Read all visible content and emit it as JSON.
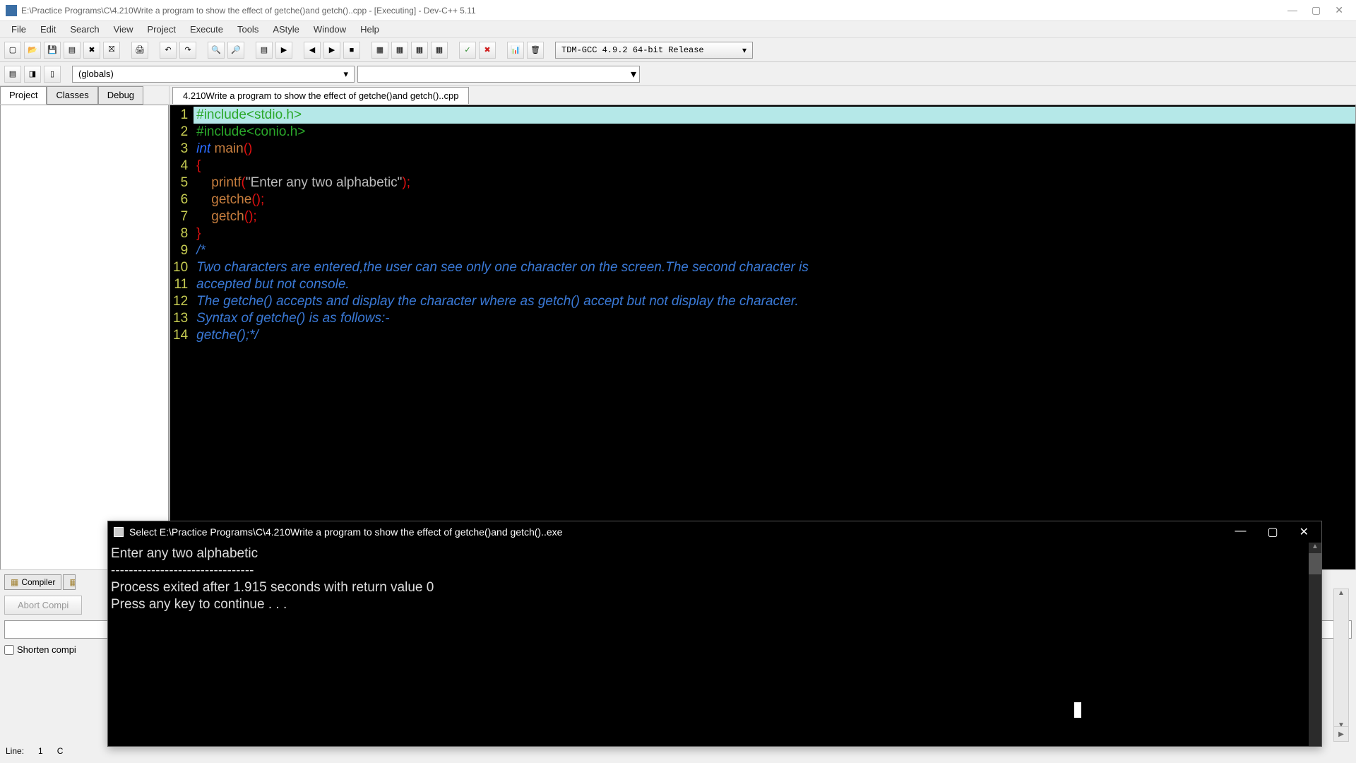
{
  "window": {
    "title": "E:\\Practice Programs\\C\\4.210Write a program to show the effect of getche()and getch()..cpp - [Executing] - Dev-C++ 5.11"
  },
  "menus": [
    "File",
    "Edit",
    "Search",
    "View",
    "Project",
    "Execute",
    "Tools",
    "AStyle",
    "Window",
    "Help"
  ],
  "compiler_profile": "TDM-GCC 4.9.2 64-bit Release",
  "globals_label": "(globals)",
  "left_tabs": [
    "Project",
    "Classes",
    "Debug"
  ],
  "editor_tab": "4.210Write a program to show the effect of getche()and getch()..cpp",
  "code_lines": [
    {
      "n": 1,
      "hl": true,
      "parts": [
        {
          "cls": "tok-pre",
          "t": "#include<stdio.h>"
        }
      ]
    },
    {
      "n": 2,
      "parts": [
        {
          "cls": "tok-pre",
          "t": "#include<conio.h>"
        }
      ]
    },
    {
      "n": 3,
      "parts": [
        {
          "cls": "tok-kw",
          "t": "int "
        },
        {
          "cls": "tok-fn",
          "t": "main"
        },
        {
          "cls": "tok-sym",
          "t": "()"
        }
      ]
    },
    {
      "n": 4,
      "parts": [
        {
          "cls": "tok-brace",
          "t": "{"
        }
      ]
    },
    {
      "n": 5,
      "parts": [
        {
          "cls": "tok-plain",
          "t": "    "
        },
        {
          "cls": "tok-fn",
          "t": "printf"
        },
        {
          "cls": "tok-sym",
          "t": "("
        },
        {
          "cls": "tok-str",
          "t": "\"Enter any two alphabetic\""
        },
        {
          "cls": "tok-sym",
          "t": ");"
        }
      ]
    },
    {
      "n": 6,
      "parts": [
        {
          "cls": "tok-plain",
          "t": "    "
        },
        {
          "cls": "tok-fn",
          "t": "getche"
        },
        {
          "cls": "tok-sym",
          "t": "();"
        }
      ]
    },
    {
      "n": 7,
      "parts": [
        {
          "cls": "tok-plain",
          "t": "    "
        },
        {
          "cls": "tok-fn",
          "t": "getch"
        },
        {
          "cls": "tok-sym",
          "t": "();"
        }
      ]
    },
    {
      "n": 8,
      "parts": [
        {
          "cls": "tok-brace",
          "t": "}"
        }
      ]
    },
    {
      "n": 9,
      "parts": [
        {
          "cls": "tok-comment",
          "t": "/*"
        }
      ]
    },
    {
      "n": 10,
      "parts": [
        {
          "cls": "tok-comment",
          "t": "Two characters are entered,the user can see only one character on the screen.The second character is"
        }
      ]
    },
    {
      "n": 11,
      "parts": [
        {
          "cls": "tok-comment",
          "t": "accepted but not console."
        }
      ]
    },
    {
      "n": 12,
      "parts": [
        {
          "cls": "tok-comment",
          "t": "The getche() accepts and display the character where as getch() accept but not display the character."
        }
      ]
    },
    {
      "n": 13,
      "parts": [
        {
          "cls": "tok-comment",
          "t": "Syntax of getche() is as follows:-"
        }
      ]
    },
    {
      "n": 14,
      "parts": [
        {
          "cls": "tok-comment",
          "t": "getche();*/"
        }
      ]
    }
  ],
  "bottom_tabs": {
    "compiler": "Compiler"
  },
  "abort_label": "Abort Compi",
  "shorten_label": "Shorten compi",
  "status": {
    "line_label": "Line:",
    "line_val": "1",
    "col_label": "C"
  },
  "console": {
    "title": "Select E:\\Practice Programs\\C\\4.210Write a program to show the effect of getche()and getch()..exe",
    "lines": [
      "Enter any two alphabetic",
      "--------------------------------",
      "Process exited after 1.915 seconds with return value 0",
      "Press any key to continue . . ."
    ]
  }
}
